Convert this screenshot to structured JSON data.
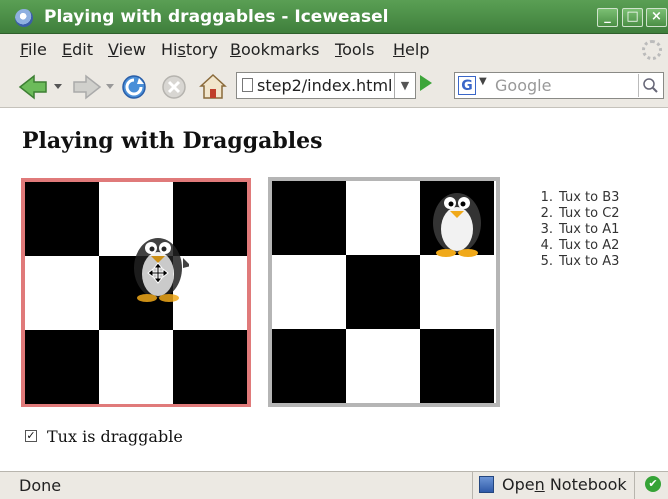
{
  "window": {
    "title": "Playing with draggables - Iceweasel",
    "controls": {
      "minimize": "_",
      "maximize": "□",
      "close": "×"
    }
  },
  "menu": {
    "items": [
      {
        "label": "File",
        "accel": "F",
        "rest": "ile"
      },
      {
        "label": "Edit",
        "accel": "E",
        "rest": "dit"
      },
      {
        "label": "View",
        "accel": "V",
        "rest": "iew"
      },
      {
        "label": "History",
        "pre": "Hi",
        "accel": "s",
        "rest": "tory"
      },
      {
        "label": "Bookmarks",
        "accel": "B",
        "rest": "ookmarks"
      },
      {
        "label": "Tools",
        "accel": "T",
        "rest": "ools"
      },
      {
        "label": "Help",
        "accel": "H",
        "rest": "elp"
      }
    ]
  },
  "toolbar": {
    "url": "step2/index.html",
    "search_placeholder": "Google",
    "search_engine": "G",
    "icons": [
      "back-icon",
      "forward-icon",
      "reload-icon",
      "stop-icon",
      "home-icon",
      "go-icon",
      "search-icon"
    ]
  },
  "page": {
    "heading": "Playing with Draggables",
    "steps": [
      {
        "num": "1.",
        "text": "Tux to B3"
      },
      {
        "num": "2.",
        "text": "Tux to C2"
      },
      {
        "num": "3.",
        "text": "Tux to A1"
      },
      {
        "num": "4.",
        "text": "Tux to A2"
      },
      {
        "num": "5.",
        "text": "Tux to A3"
      }
    ],
    "checkbox_label": "Tux is draggable",
    "checkbox_checked": true,
    "board_colors": {
      "active_border": "#e07a7a",
      "inactive_border": "#b5b5b5"
    }
  },
  "statusbar": {
    "status": "Done",
    "notebook_label": "Open Notebook",
    "notebook_accel_pre": "Ope",
    "notebook_accel": "n",
    "notebook_accel_post": " Notebook"
  }
}
